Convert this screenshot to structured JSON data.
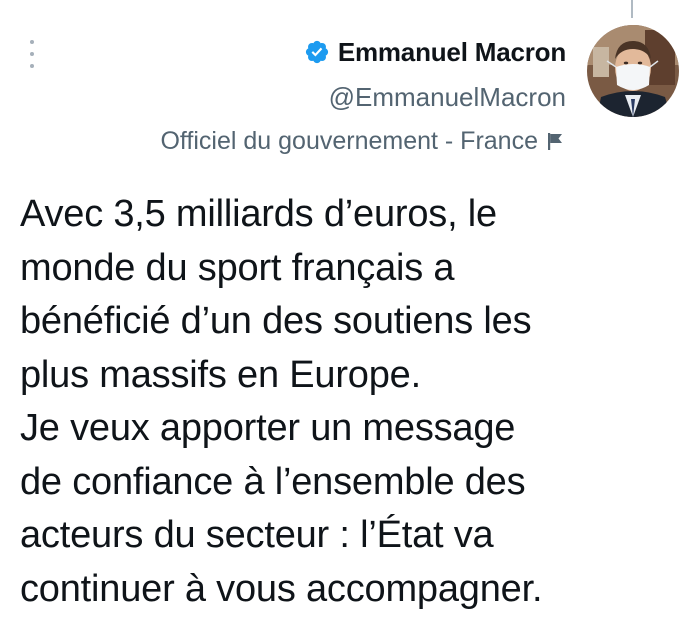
{
  "author": {
    "display_name": "Emmanuel Macron",
    "handle": "@EmmanuelMacron",
    "label": "Officiel du gouvernement - France",
    "verified": true,
    "label_icon": "flag-icon",
    "verified_icon": "verified-badge-icon",
    "accent_color": "#1d9bf0"
  },
  "tweet": {
    "lines": [
      "Avec 3,5 milliards d’euros, le",
      "monde du sport français a",
      "bénéficié d’un des soutiens les",
      "plus massifs en Europe.",
      "Je veux apporter un message",
      "de confiance à l’ensemble des",
      "acteurs du secteur : l’État va",
      "continuer à vous accompagner."
    ]
  },
  "menu": {
    "icon": "more-vertical-icon"
  }
}
